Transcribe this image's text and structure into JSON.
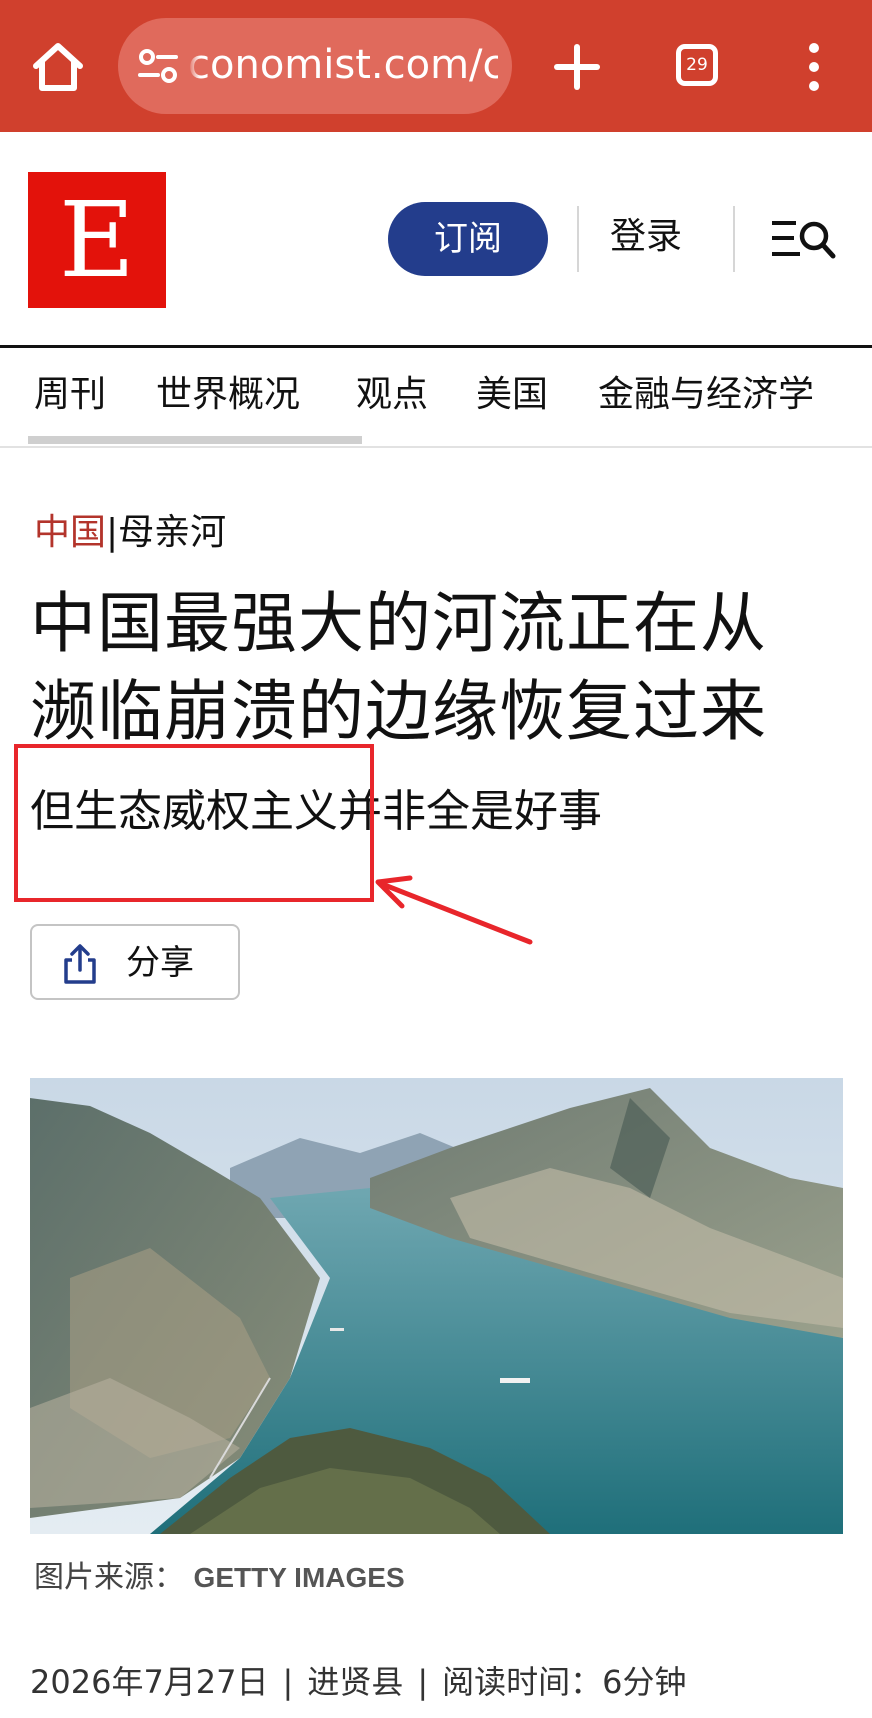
{
  "browser": {
    "url": "conomist.com/c",
    "tab_count": "29"
  },
  "header": {
    "logo_letter": "E",
    "subscribe_label": "订阅",
    "login_label": "登录"
  },
  "section_nav": {
    "items": [
      {
        "label": "周刊"
      },
      {
        "label": "世界概况"
      },
      {
        "label": "观点"
      },
      {
        "label": "美国"
      },
      {
        "label": "金融与经济学"
      }
    ]
  },
  "article": {
    "kicker_section": "中国",
    "kicker_separator": "|",
    "kicker_topic": "母亲河",
    "headline_line1": "中国最强大的河流正在从",
    "headline_line2": "濒临崩溃的边缘恢复过来",
    "dek": "但生态威权主义并非全是好事",
    "share_label": "分享",
    "image_caption_label": "图片来源：",
    "image_credit": "GETTY IMAGES",
    "date": "2026年7月27日",
    "location": "进贤县",
    "read_time": "阅读时间：6分钟",
    "meta_separator": "|"
  },
  "colors": {
    "browser_bar": "#d0402d",
    "logo_red": "#e3120b",
    "subscribe_blue": "#233d8c",
    "kicker_red": "#b3342b",
    "annotation_red": "#e8262b"
  }
}
